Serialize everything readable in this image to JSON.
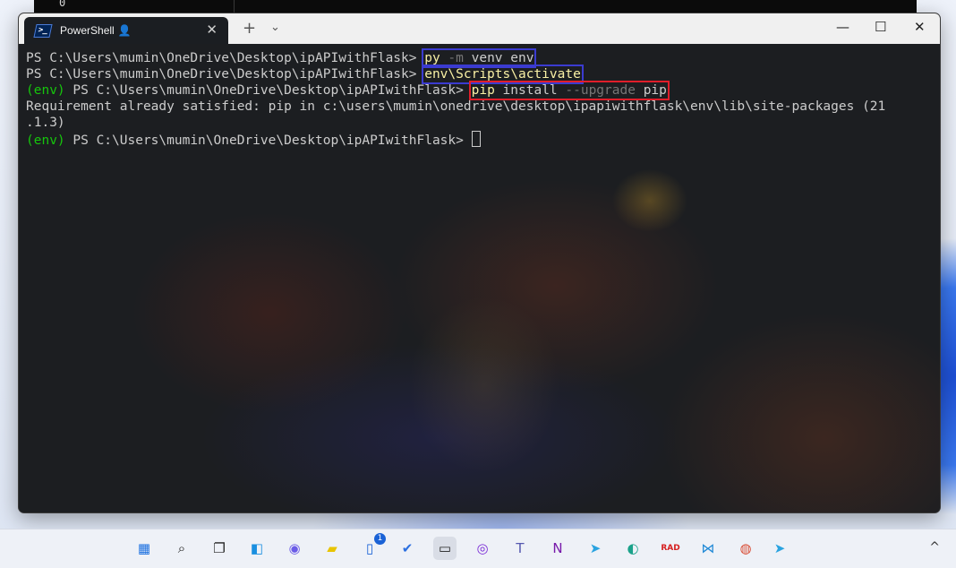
{
  "window": {
    "tab_title": "PowerShell",
    "tab_icon": "powershell-icon",
    "tab_close": "✕",
    "new_tab": "+",
    "dropdown": "⌄",
    "minimize": "—",
    "maximize": "☐",
    "close": "✕"
  },
  "top_strip": {
    "glyph": "0"
  },
  "terminal": {
    "prompt1": "PS C:\\Users\\mumin\\OneDrive\\Desktop\\ipAPIwithFlask> ",
    "cmd1_a": "py",
    "cmd1_b": " -m",
    "cmd1_c": " venv env",
    "prompt2": "PS C:\\Users\\mumin\\OneDrive\\Desktop\\ipAPIwithFlask> ",
    "cmd2": "env\\Scripts\\activate",
    "env_tag": "(env)",
    "prompt3": " PS C:\\Users\\mumin\\OneDrive\\Desktop\\ipAPIwithFlask> ",
    "cmd3_a": "pip",
    "cmd3_b": " install",
    "cmd3_c": " --upgrade",
    "cmd3_d": " pip",
    "output1": "Requirement already satisfied: pip in c:\\users\\mumin\\onedrive\\desktop\\ipapiwithflask\\env\\lib\\site-packages (21",
    "output2": ".1.3)",
    "prompt4": " PS C:\\Users\\mumin\\OneDrive\\Desktop\\ipAPIwithFlask> "
  },
  "taskbar": {
    "items": [
      {
        "name": "start-icon",
        "glyph": "▦",
        "color": "#1a6fe0"
      },
      {
        "name": "search-icon",
        "glyph": "⌕",
        "color": "#222"
      },
      {
        "name": "task-view-icon",
        "glyph": "❐",
        "color": "#222"
      },
      {
        "name": "widgets-icon",
        "glyph": "◧",
        "color": "#1a8fe0"
      },
      {
        "name": "chat-icon",
        "glyph": "◉",
        "color": "#6b5ce7"
      },
      {
        "name": "sticky-notes-icon",
        "glyph": "▰",
        "color": "#e8c400"
      },
      {
        "name": "phone-link-icon",
        "glyph": "▯",
        "color": "#1a62d6",
        "badge": "1"
      },
      {
        "name": "todo-icon",
        "glyph": "✔",
        "color": "#2b6fe0"
      },
      {
        "name": "terminal-icon",
        "glyph": "▭",
        "color": "#222"
      },
      {
        "name": "podcast-icon",
        "glyph": "◎",
        "color": "#7a2bd6"
      },
      {
        "name": "teams-icon",
        "glyph": "T",
        "color": "#5558af"
      },
      {
        "name": "onenote-icon",
        "glyph": "N",
        "color": "#7719aa"
      },
      {
        "name": "telegram-icon",
        "glyph": "➤",
        "color": "#2aa3e0"
      },
      {
        "name": "edge-icon",
        "glyph": "◐",
        "color": "#1ba28a"
      },
      {
        "name": "rad-icon",
        "glyph": "RAD",
        "color": "#d62020"
      },
      {
        "name": "vscode-icon",
        "glyph": "⋈",
        "color": "#1e88d6"
      },
      {
        "name": "chrome-icon",
        "glyph": "◍",
        "color": "#d84b33"
      },
      {
        "name": "telegram-icon-2",
        "glyph": "➤",
        "color": "#2aa3e0"
      }
    ],
    "overflow": "^"
  }
}
